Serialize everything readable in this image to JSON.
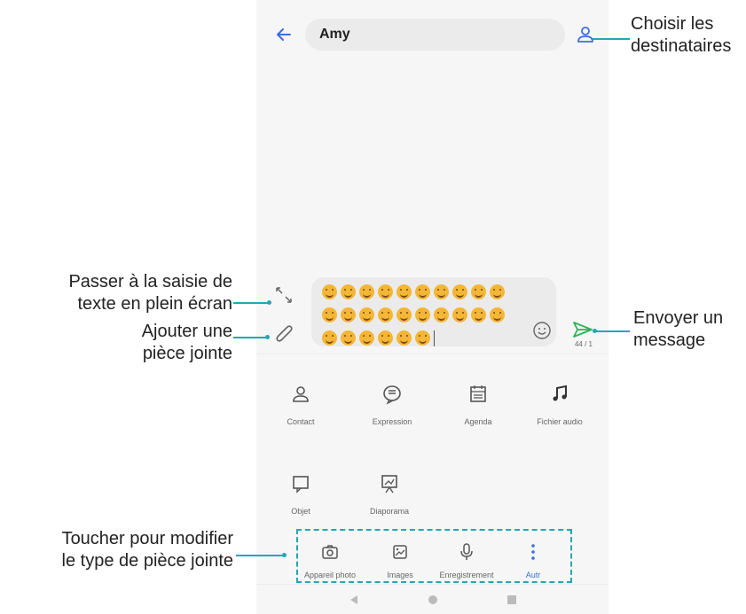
{
  "header": {
    "recipient": "Amy"
  },
  "compose": {
    "char_count": "44 / 1"
  },
  "attachments_grid": [
    {
      "label": "Contact",
      "icon": "contact-icon"
    },
    {
      "label": "Expression",
      "icon": "expression-icon"
    },
    {
      "label": "Agenda",
      "icon": "calendar-icon"
    },
    {
      "label": "Fichier audio",
      "icon": "music-icon"
    },
    {
      "label": "Objet",
      "icon": "object-icon"
    },
    {
      "label": "Diaporama",
      "icon": "slideshow-icon"
    }
  ],
  "tabbar": [
    {
      "label": "Appareil photo",
      "icon": "camera-icon"
    },
    {
      "label": "Images",
      "icon": "image-icon"
    },
    {
      "label": "Enregistrement",
      "icon": "microphone-icon"
    },
    {
      "label": "Autr",
      "icon": "more-vertical-icon"
    }
  ],
  "callouts": {
    "choose_recipients_1": "Choisir les",
    "choose_recipients_2": "destinataires",
    "fullscreen_1": "Passer à la saisie de",
    "fullscreen_2": "texte en plein écran",
    "attach_1": "Ajouter une",
    "attach_2": "pièce jointe",
    "send_1": "Envoyer un",
    "send_2": "message",
    "tap_type_1": "Toucher pour modifier",
    "tap_type_2": "le type de pièce jointe"
  },
  "colors": {
    "accent": "#3a6fd8",
    "callout": "#22a7b5",
    "send": "#2eb35a"
  }
}
